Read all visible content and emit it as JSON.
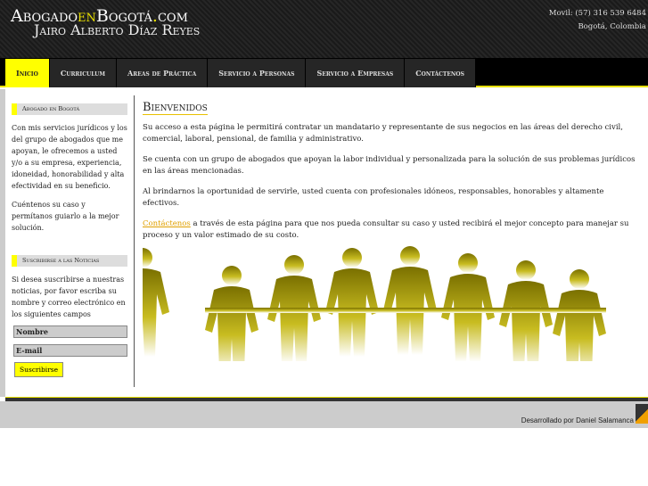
{
  "header": {
    "logo_pre": "Abogado",
    "logo_en": "en",
    "logo_mid": "Bogotá",
    "logo_dot": ".",
    "logo_post": "com",
    "subtitle": "Jairo Alberto Díaz Reyes",
    "phone": "Movil: (57) 316 539 6484",
    "city": "Bogotá, Colombia"
  },
  "nav": {
    "tabs": [
      {
        "label": "Inicio"
      },
      {
        "label": "Curriculum"
      },
      {
        "label": "Areas de Práctica"
      },
      {
        "label": "Servicio a Personas"
      },
      {
        "label": "Servicio a Empresas"
      },
      {
        "label": "Contáctenos"
      }
    ]
  },
  "sidebar": {
    "about_title": "Abogado en Bogotá",
    "about_p1": "Con mis servicios jurídicos y los del grupo de abogados que me apoyan, le ofrecemos a usted y/o a su empresa, experiencia, idoneidad, honorabilidad y alta efectividad en su beneficio.",
    "about_p2": "Cuéntenos su caso y permítanos guiarlo a la mejor solución.",
    "news_title": "Suscribirse a las Noticias",
    "news_p": "Si desea suscribirse a nuestras noticias, por favor escriba su nombre y correo electrónico en los siguientes campos",
    "name_value": "Nombre",
    "email_value": "E-mail",
    "subscribe_label": "Suscribirse"
  },
  "main": {
    "title": "Bienvenidos",
    "p1": "Su acceso a esta página le permitirá contratar un mandatario y representante de sus negocios en las áreas del derecho civil, comercial, laboral, pensional, de familia y administrativo.",
    "p2": "Se cuenta con un grupo de abogados que apoyan la labor individual y personalizada para la solución de sus problemas jurídicos en las áreas mencionadas.",
    "p3": "Al brindarnos la oportunidad de servirle, usted cuenta con profesionales idóneos, responsables, honorables y altamente efectivos.",
    "p4_link": "Contáctenos",
    "p4_rest": " a través de esta página para que nos pueda consultar su caso y usted recibirá el mejor concepto para manejar su proceso y un valor estimado de su costo."
  },
  "footer": {
    "credit": "Desarrollado por Daniel Salamanca"
  }
}
